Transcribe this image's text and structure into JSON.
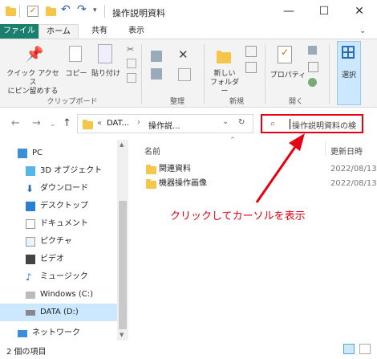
{
  "title": "操作説明資料",
  "window_controls": {
    "minimize": "—",
    "maximize": "☐",
    "close": "✕"
  },
  "tabs": [
    "ファイル",
    "ホーム",
    "共有",
    "表示"
  ],
  "ribbon": {
    "clipboard": {
      "pin_label_1": "クイック アクセス",
      "pin_label_2": "にピン留めする",
      "copy_label": "コピー",
      "paste_label": "貼り付け",
      "group_label": "クリップボード"
    },
    "organize": {
      "group_label": "整理"
    },
    "new": {
      "folder_label_1": "新しい",
      "folder_label_2": "フォルダー",
      "group_label": "新規"
    },
    "open": {
      "properties_label": "プロパティ",
      "group_label": "開く"
    },
    "select": {
      "label": "選択"
    }
  },
  "address": {
    "chevrons": "«",
    "segment_1": "DAT...",
    "separator": "›",
    "segment_2": "操作説...",
    "dropdown": "⌄",
    "refresh": "↻"
  },
  "search": {
    "value": "操作説明資料の検"
  },
  "sidebar": {
    "items": [
      {
        "label": "PC"
      },
      {
        "label": "3D オブジェクト"
      },
      {
        "label": "ダウンロード"
      },
      {
        "label": "デスクトップ"
      },
      {
        "label": "ドキュメント"
      },
      {
        "label": "ピクチャ"
      },
      {
        "label": "ビデオ"
      },
      {
        "label": "ミュージック"
      },
      {
        "label": "Windows (C:)"
      },
      {
        "label": "DATA (D:)"
      },
      {
        "label": "ネットワーク"
      }
    ]
  },
  "columns": {
    "name": "名前",
    "modified": "更新日時"
  },
  "files": [
    {
      "name": "関連資料",
      "modified": "2022/08/13 1"
    },
    {
      "name": "機器操作画像",
      "modified": "2022/08/13 1"
    }
  ],
  "annotation": "クリックしてカーソルを表示",
  "status": {
    "count": "2 個の項目"
  },
  "colors": {
    "file_tab": "#1a7f6f",
    "highlight": "#e60012",
    "folder": "#f6c64a",
    "selected": "#cce8ff"
  }
}
